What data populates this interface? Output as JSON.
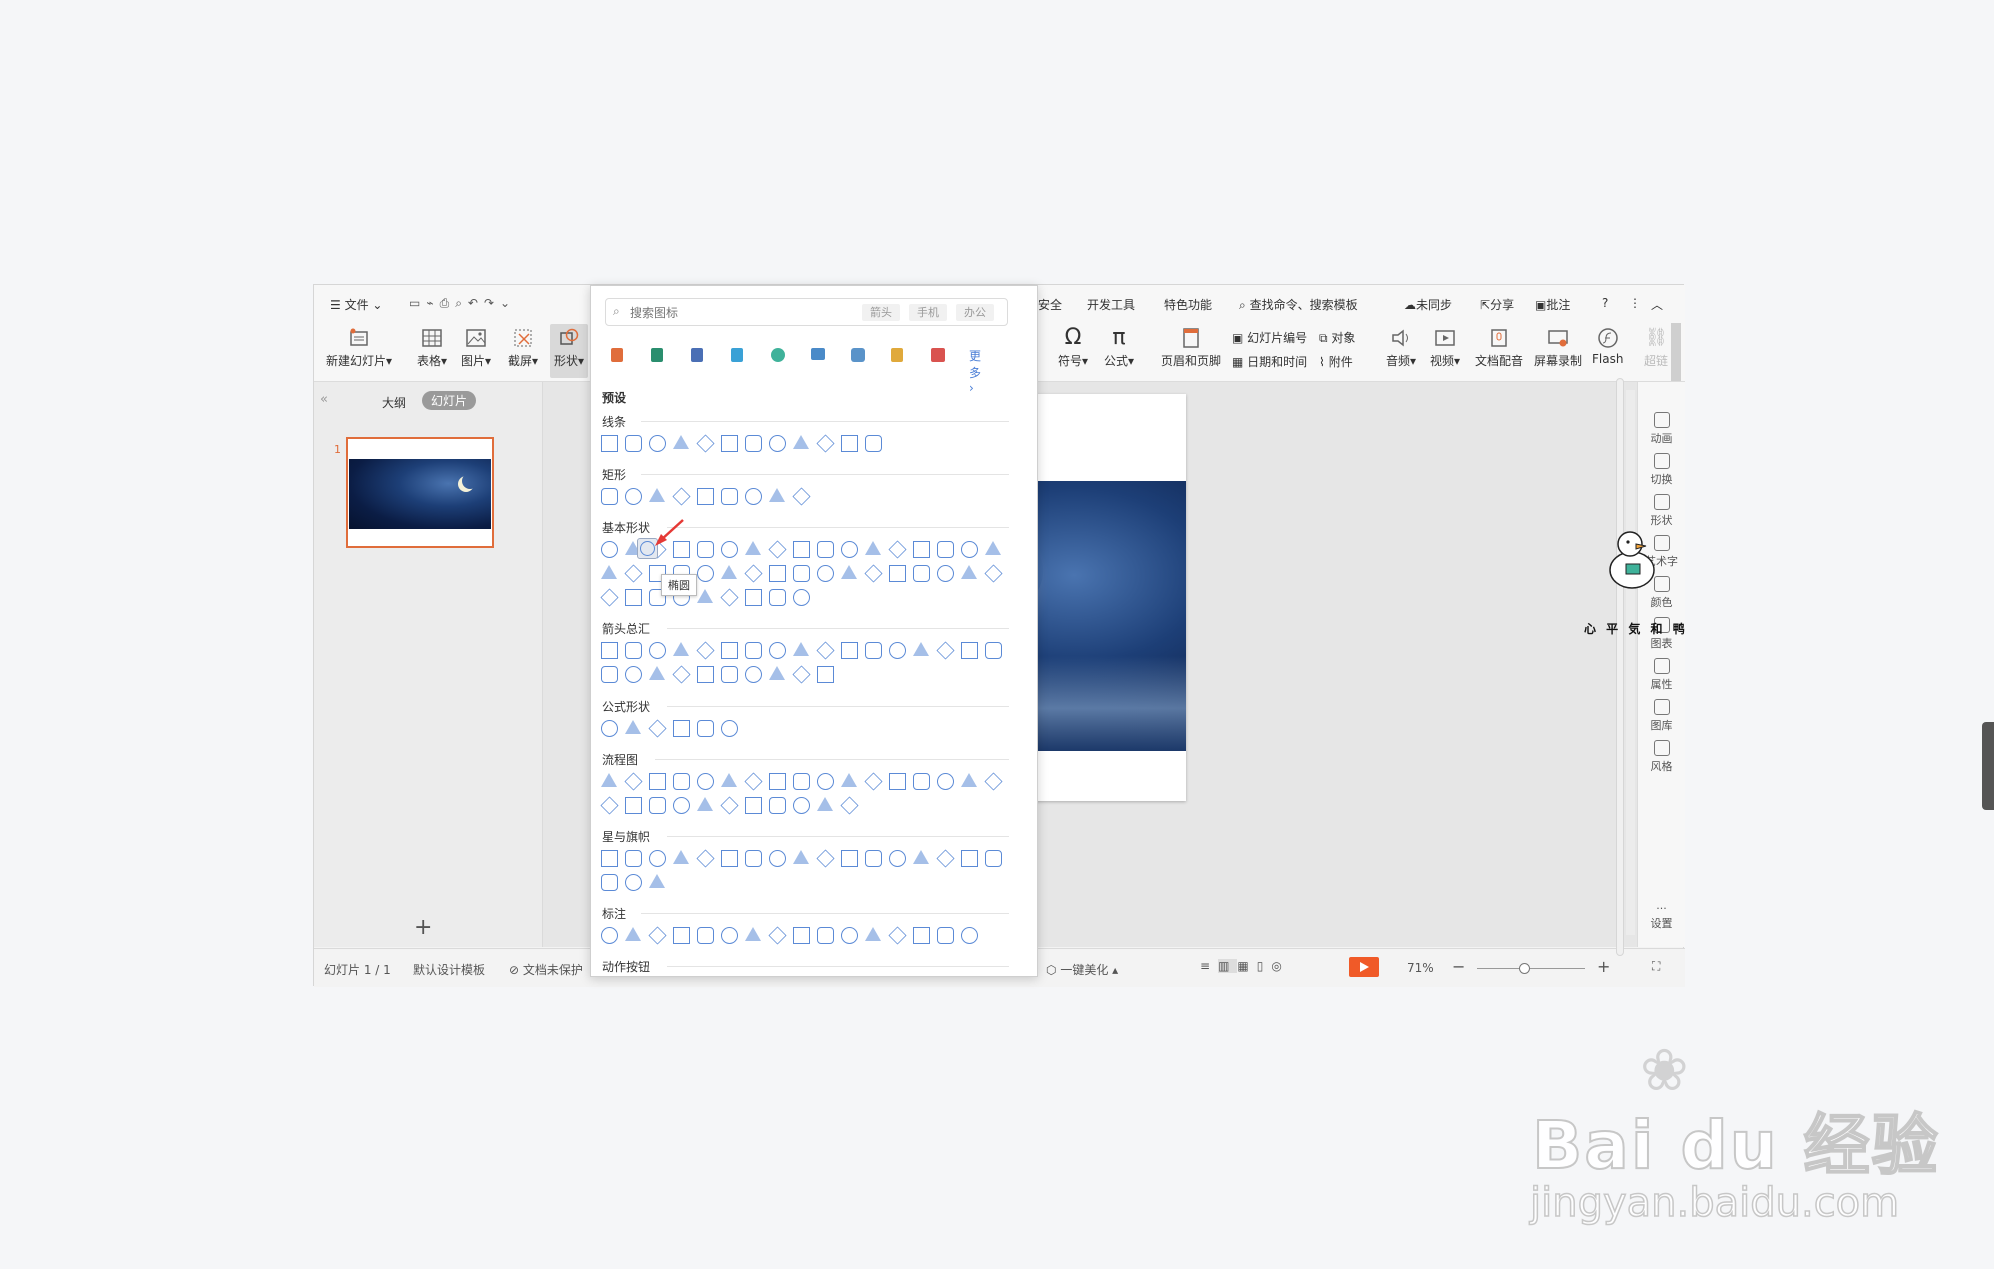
{
  "window": {
    "menu_file": "文件",
    "top_tabs": [
      "安全",
      "开发工具",
      "特色功能"
    ],
    "search_cmd": "查找命令、搜索模板",
    "sync": "未同步",
    "share": "分享",
    "annotate": "批注",
    "help": "?"
  },
  "ribbon": {
    "new_slide": "新建幻灯片",
    "table": "表格",
    "picture": "图片",
    "screenshot": "截屏",
    "shape": "形状",
    "symbol": "符号",
    "formula": "公式",
    "header_footer": "页眉和页脚",
    "slide_number": "幻灯片编号",
    "object": "对象",
    "datetime": "日期和时间",
    "attachment": "附件",
    "audio": "音频",
    "video": "视频",
    "doc_audio": "文档配音",
    "screen_record": "屏幕录制",
    "flash": "Flash",
    "hyperlink": "超链"
  },
  "left_pane": {
    "tab_outline": "大纲",
    "tab_slides": "幻灯片",
    "slide_index": "1",
    "add": "+"
  },
  "status": {
    "slide_count": "幻灯片 1 / 1",
    "template": "默认设计模板",
    "protection": "文档未保护",
    "beautify": "一键美化",
    "zoom": "71%"
  },
  "right_panel": {
    "items": [
      "动画",
      "切换",
      "形状",
      "艺术字",
      "颜色",
      "图表",
      "属性",
      "图库",
      "风格",
      "设置"
    ]
  },
  "shape_panel": {
    "search_placeholder": "搜索图标",
    "chips": [
      "箭头",
      "手机",
      "办公"
    ],
    "more": "更多",
    "preset": "预设",
    "sections": {
      "lines": "线条",
      "rect": "矩形",
      "basic": "基本形状",
      "arrows": "箭头总汇",
      "formula": "公式形状",
      "flowchart": "流程图",
      "stars": "星与旗帜",
      "callouts": "标注",
      "action": "动作按钮"
    },
    "tooltip": "椭圆"
  },
  "watermark": {
    "brand": "Bai du 经验",
    "url": "jingyan.baidu.com"
  },
  "sticker_text": "心 平 気 和 鸭",
  "colors": {
    "accent": "#e06d3b",
    "shape_stroke": "#5b8ad6",
    "play": "#f05a28"
  }
}
